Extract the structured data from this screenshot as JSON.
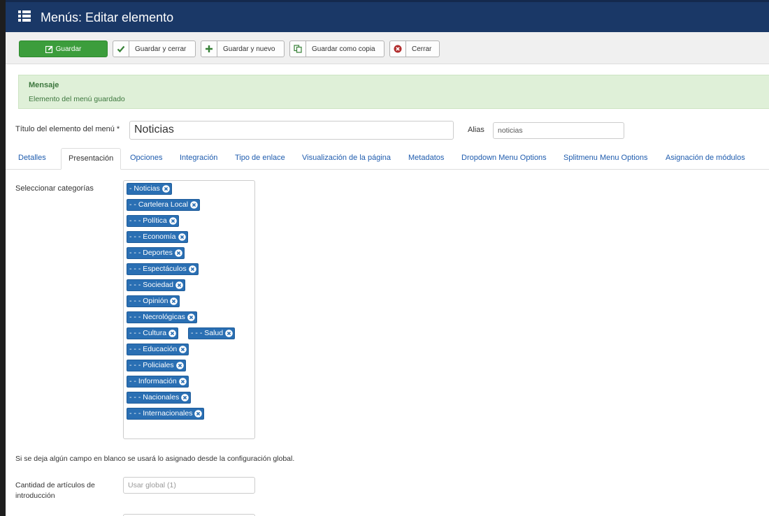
{
  "header": {
    "title": "Menús: Editar elemento"
  },
  "toolbar": {
    "save": "Guardar",
    "save_close": "Guardar y cerrar",
    "save_new": "Guardar y nuevo",
    "save_copy": "Guardar como copia",
    "close": "Cerrar"
  },
  "message": {
    "heading": "Mensaje",
    "text": "Elemento del menú guardado"
  },
  "form": {
    "title_label": "Título del elemento del menú *",
    "title_value": "Noticias",
    "alias_label": "Alias",
    "alias_value": "noticias"
  },
  "tabs": [
    "Detalles",
    "Presentación",
    "Opciones",
    "Integración",
    "Tipo de enlace",
    "Visualización de la página",
    "Metadatos",
    "Dropdown Menu Options",
    "Splitmenu Menu Options",
    "Asignación de módulos"
  ],
  "active_tab": "Presentación",
  "categories": {
    "label": "Seleccionar categorías",
    "tags": [
      "- Noticias",
      "- - Cartelera Local",
      "- - - Política",
      "- - - Economía",
      "- - - Deportes",
      "- - - Espectáculos",
      "- - - Sociedad",
      "- - - Opinión",
      "- - - Necrológicas",
      "- - - Cultura",
      "- - - Salud",
      "- - - Educación",
      "- - - Policiales",
      "- - Información",
      "- - - Nacionales",
      "- - - Internacionales"
    ]
  },
  "hint": "Si se deja algún campo en blanco se usará lo asignado desde la configuración global.",
  "intro_count": {
    "label": "Cantidad de artículos de introducción",
    "placeholder": "Usar global (1)"
  },
  "colors": {
    "header_bg": "#1a3867",
    "save_green": "#3c9d3c",
    "tag_blue": "#2a6fb3",
    "message_bg": "#dff0d8",
    "link_blue": "#1f5cae"
  },
  "icons": {
    "header": "list-icon",
    "save": "edit-icon",
    "save_close": "check-icon",
    "save_new": "plus-icon",
    "save_copy": "copy-icon",
    "close": "cancel-icon",
    "tag_remove": "remove-icon"
  }
}
